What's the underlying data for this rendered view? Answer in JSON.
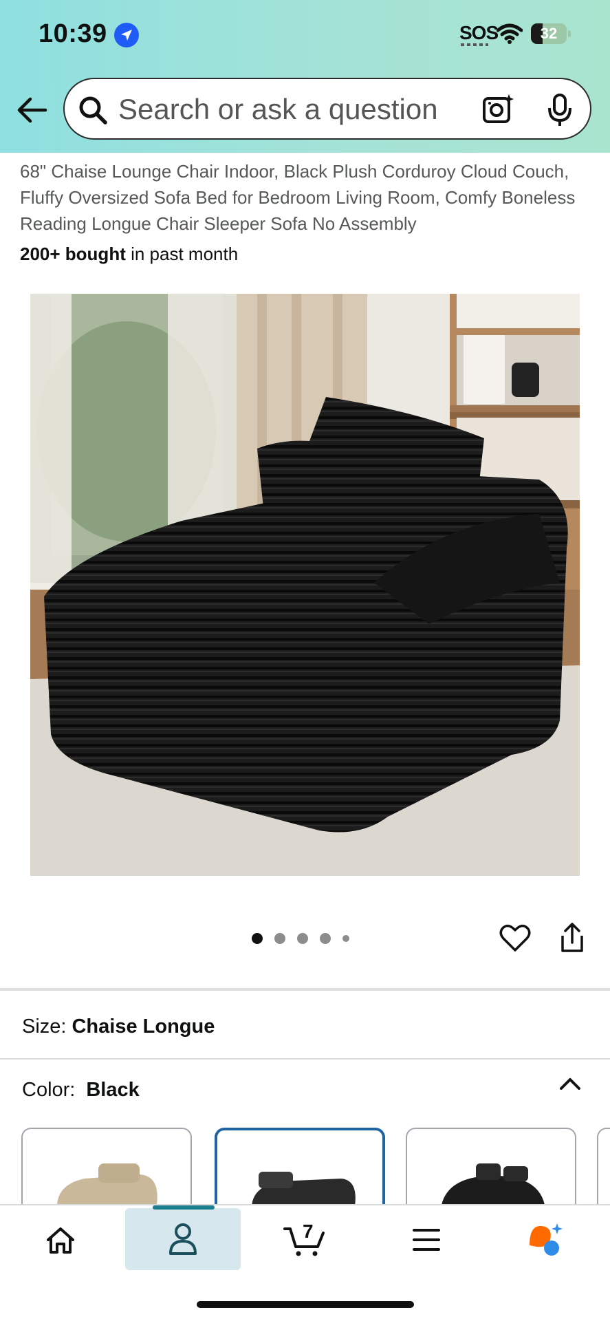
{
  "status_bar": {
    "time": "10:39",
    "sos": "SOS",
    "battery": "32",
    "battery_level": 0.32
  },
  "search": {
    "placeholder": "Search or ask a question"
  },
  "product": {
    "title": "68\" Chaise Lounge Chair Indoor, Black Plush Corduroy Cloud Couch, Fluffy Oversized Sofa Bed for Bedroom Living Room, Comfy Boneless Reading Longue Chair Sleeper Sofa No Assembly",
    "bought_bold": "200+ bought",
    "bought_rest": " in past month"
  },
  "gallery": {
    "image_count": 5,
    "active_index": 0
  },
  "variations": {
    "size_label": "Size:",
    "size_value": "Chaise Longue",
    "color_label": "Color:",
    "color_value": "Black",
    "swatches": [
      {
        "color": "#c9b99a",
        "selected": false
      },
      {
        "color": "#2a2a2a",
        "selected": true
      },
      {
        "color": "#1c1c1c",
        "selected": false
      }
    ]
  },
  "bottom_nav": {
    "cart_count": "7",
    "items": [
      "home-icon",
      "account-icon",
      "cart-icon",
      "menu-icon",
      "rufus-icon"
    ],
    "active": "account-icon"
  },
  "colors": {
    "header_gradient_start": "#8fdfe0",
    "header_gradient_end": "#a9e4cf",
    "selected_swatch_border": "#2162a1",
    "nav_active_bar": "#1b7e8f",
    "rufus_orange": "#ff6a00",
    "rufus_blue": "#2e8ce8"
  }
}
